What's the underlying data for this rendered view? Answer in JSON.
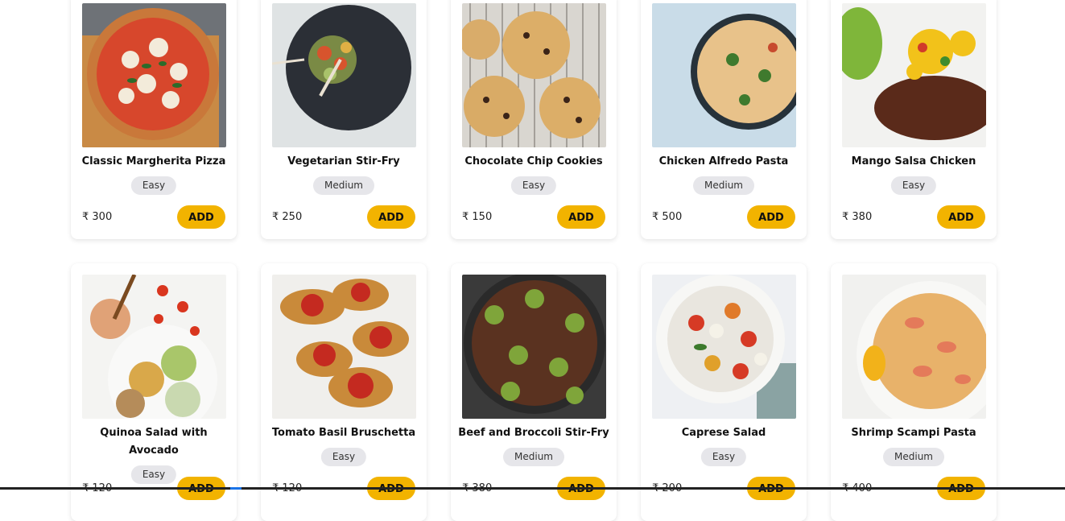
{
  "currency": "₹",
  "add_label": "ADD",
  "recipes": [
    {
      "name": "Classic Margherita Pizza",
      "difficulty": "Easy",
      "price": "₹ 300"
    },
    {
      "name": "Vegetarian Stir-Fry",
      "difficulty": "Medium",
      "price": "₹ 250"
    },
    {
      "name": "Chocolate Chip Cookies",
      "difficulty": "Easy",
      "price": "₹ 150"
    },
    {
      "name": "Chicken Alfredo Pasta",
      "difficulty": "Medium",
      "price": "₹ 500"
    },
    {
      "name": "Mango Salsa Chicken",
      "difficulty": "Easy",
      "price": "₹ 380"
    },
    {
      "name": "Quinoa Salad with Avocado",
      "difficulty": "Easy",
      "price": "₹ 120"
    },
    {
      "name": "Tomato Basil Bruschetta",
      "difficulty": "Easy",
      "price": "₹ 120"
    },
    {
      "name": "Beef and Broccoli Stir-Fry",
      "difficulty": "Medium",
      "price": "₹ 380"
    },
    {
      "name": "Caprese Salad",
      "difficulty": "Easy",
      "price": "₹ 200"
    },
    {
      "name": "Shrimp Scampi Pasta",
      "difficulty": "Medium",
      "price": "₹ 400"
    }
  ],
  "colors": {
    "add_button": "#f2b300",
    "badge_bg": "#e6e6ea"
  }
}
